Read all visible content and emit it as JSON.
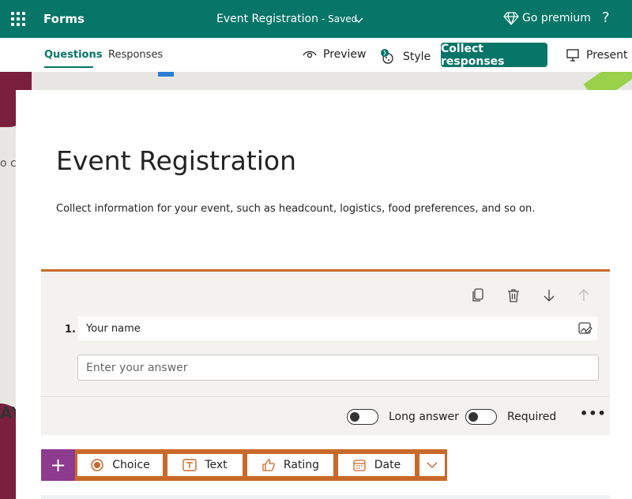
{
  "app": {
    "name": "Forms",
    "doc_title": "Event Registration",
    "doc_status": "- Saved",
    "premium_label": "Go premium",
    "help_label": "?"
  },
  "tabs": [
    {
      "label": "Questions",
      "active": true
    },
    {
      "label": "Responses",
      "active": false
    }
  ],
  "commands": {
    "preview": "Preview",
    "style": "Style",
    "collect": "Collect responses",
    "present": "Present"
  },
  "background": {
    "letters_left": "o c",
    "letters_left2": "AY"
  },
  "form": {
    "title": "Event Registration",
    "description": "Collect information for your event, such as headcount, logistics, food preferences, and so on."
  },
  "question": {
    "number": "1.",
    "title": "Your name",
    "answer_placeholder": "Enter your answer",
    "long_answer_label": "Long answer",
    "long_answer_on": false,
    "required_label": "Required",
    "required_on": false,
    "more_label": "•••"
  },
  "add_toolbar": {
    "plus_label": "+",
    "choice": "Choice",
    "text": "Text",
    "rating": "Rating",
    "date": "Date"
  },
  "colors": {
    "brand": "#077568",
    "accent_orange": "#c8692a",
    "add_purple": "#8c3b8f"
  }
}
